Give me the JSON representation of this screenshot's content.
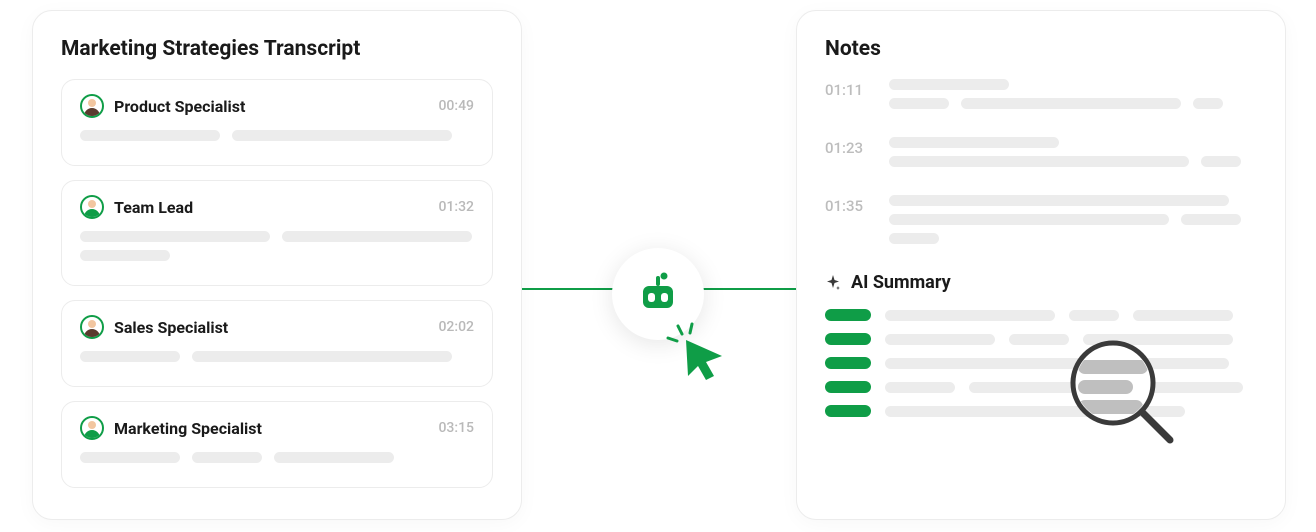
{
  "colors": {
    "accent": "#0f9d47",
    "skeleton": "#ececec",
    "muted": "#bdbdbd",
    "text": "#1a1a1a"
  },
  "transcript": {
    "title": "Marketing Strategies Transcript",
    "entries": [
      {
        "speaker": "Product Specialist",
        "time": "00:49",
        "avatar": "female"
      },
      {
        "speaker": "Team Lead",
        "time": "01:32",
        "avatar": "male"
      },
      {
        "speaker": "Sales Specialist",
        "time": "02:02",
        "avatar": "female"
      },
      {
        "speaker": "Marketing Specialist",
        "time": "03:15",
        "avatar": "male"
      }
    ]
  },
  "notes": {
    "title": "Notes",
    "items": [
      {
        "time": "01:11"
      },
      {
        "time": "01:23"
      },
      {
        "time": "01:35"
      }
    ],
    "ai_summary_label": "AI Summary"
  },
  "icons": {
    "bot": "bot-icon",
    "cursor": "cursor-click-icon",
    "magnifier": "magnifier-icon",
    "sparkle": "sparkle-icon"
  }
}
